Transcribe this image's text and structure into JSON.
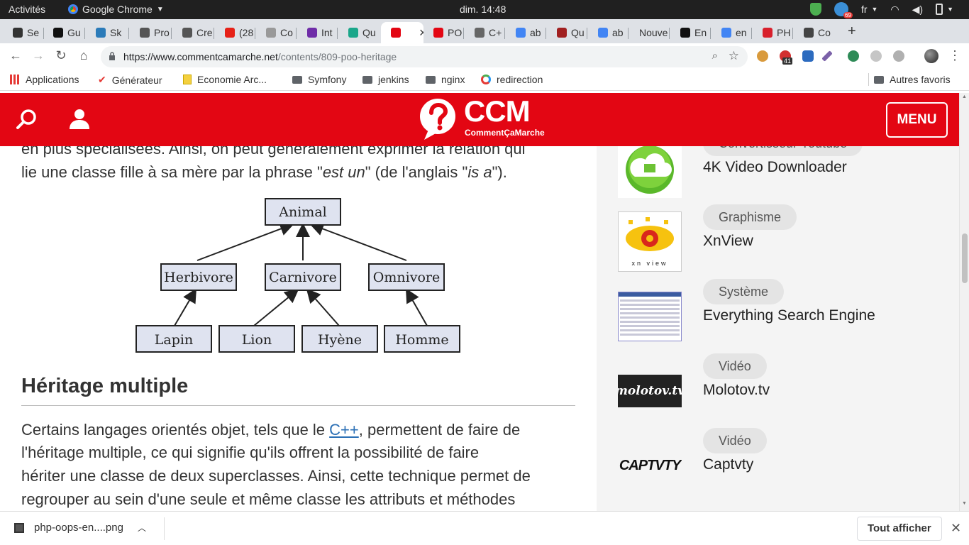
{
  "os_bar": {
    "activities": "Activités",
    "app": "Google Chrome",
    "clock": "dim. 14:48",
    "lang": "fr",
    "badge": "69"
  },
  "tabs": [
    {
      "label": "Se",
      "color": "#333333"
    },
    {
      "label": "Gu",
      "color": "#111111"
    },
    {
      "label": "Sk",
      "color": "#2b7bb9"
    },
    {
      "label": "Pro",
      "color": "#555555"
    },
    {
      "label": "Cre",
      "color": "#555555"
    },
    {
      "label": "(28",
      "color": "#e62117"
    },
    {
      "label": "Co",
      "color": "#999999"
    },
    {
      "label": "Int",
      "color": "#6f2da8"
    },
    {
      "label": "Qu",
      "color": "#1aa68a"
    },
    {
      "label": "",
      "color": "#e30613",
      "active": true
    },
    {
      "label": "PO",
      "color": "#e30613"
    },
    {
      "label": "C+",
      "color": "#666666"
    },
    {
      "label": "ab",
      "color": "#4285f4"
    },
    {
      "label": "Qu",
      "color": "#a12020"
    },
    {
      "label": "ab",
      "color": "#4285f4"
    },
    {
      "label": "Nouve",
      "color": "#ffffff"
    },
    {
      "label": "En",
      "color": "#111111"
    },
    {
      "label": "en",
      "color": "#4285f4"
    },
    {
      "label": "PH",
      "color": "#d8202c"
    },
    {
      "label": "Co",
      "color": "#444444"
    }
  ],
  "tab_close": "×",
  "new_tab": "+",
  "address": {
    "host": "https://www.commentcamarche.net",
    "path": "/contents/809-poo-heritage"
  },
  "extensions": {
    "badge": "41"
  },
  "bookmarks": [
    {
      "label": "Applications",
      "icon": "apps-grid-icon"
    },
    {
      "label": "Générateur",
      "icon": "check-icon"
    },
    {
      "label": "Economie Arc...",
      "icon": "note-icon"
    },
    {
      "label": "Symfony",
      "icon": "folder-icon"
    },
    {
      "label": "jenkins",
      "icon": "folder-icon"
    },
    {
      "label": "nginx",
      "icon": "folder-icon"
    },
    {
      "label": "redirection",
      "icon": "ring-icon"
    }
  ],
  "other_bookmarks": "Autres favoris",
  "site": {
    "logo": "CCM",
    "logo_sub": "CommentÇaMarche",
    "menu": "MENU",
    "brand_color": "#e30613"
  },
  "article": {
    "p1_line1": "en plus spécialisées. Ainsi, on peut généralement exprimer la relation qui",
    "p1_a": "lie une classe fille à sa mère par la phrase \"",
    "p1_em1": "est un",
    "p1_b": "\" (de l'anglais \"",
    "p1_em2": "is a",
    "p1_c": "\").",
    "diagram": {
      "root": "Animal",
      "mid": [
        "Herbivore",
        "Carnivore",
        "Omnivore"
      ],
      "leaves": [
        "Lapin",
        "Lion",
        "Hyène",
        "Homme"
      ]
    },
    "h2": "Héritage multiple",
    "p2_a": "Certains langages orientés objet, tels que le ",
    "p2_link": "C++",
    "p2_b": ", permettent de faire de",
    "p2_l2": "l'héritage multiple, ce qui signifie qu'ils offrent la possibilité de faire",
    "p2_l3": "hériter une classe de deux superclasses. Ainsi, cette technique permet de",
    "p2_l4": "regrouper au sein d'une seule et même classe les attributs et méthodes"
  },
  "sidebar": [
    {
      "category": "Convertisseur Youtube",
      "name": "4K Video Downloader"
    },
    {
      "category": "Graphisme",
      "name": "XnView",
      "thumb_text": "xn  view"
    },
    {
      "category": "Système",
      "name": "Everything Search Engine"
    },
    {
      "category": "Vidéo",
      "name": "Molotov.tv",
      "thumb_text": "molotov.tv"
    },
    {
      "category": "Vidéo",
      "name": "Captvty",
      "thumb_text": "CAPTVTY"
    }
  ],
  "download": {
    "file": "php-oops-en....png",
    "show_all": "Tout afficher"
  }
}
